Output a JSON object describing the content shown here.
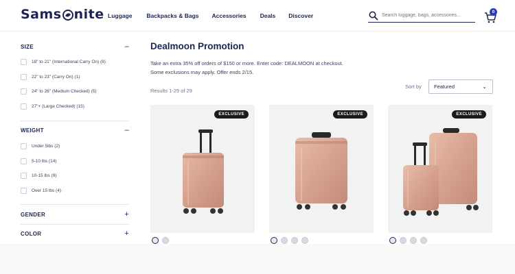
{
  "header": {
    "brand": "Samsonite",
    "nav": [
      "Luggage",
      "Backpacks & Bags",
      "Accessories",
      "Deals",
      "Discover"
    ],
    "search_placeholder": "Search luggage, bags, accessories...",
    "cart_count": "0"
  },
  "sidebar": {
    "size": {
      "label": "SIZE",
      "toggle": "–",
      "options": [
        "18\" to 21\" (International Carry On) (8)",
        "22\" to 23\" (Carry On) (1)",
        "24\" to 26\" (Medium Checked) (5)",
        "27\"+ (Large Checked) (15)"
      ]
    },
    "weight": {
      "label": "WEIGHT",
      "toggle": "–",
      "options": [
        "Under 5lbs (2)",
        "5-10 lbs (14)",
        "10-15 lbs (9)",
        "Over 15 lbs (4)"
      ]
    },
    "gender": {
      "label": "GENDER",
      "toggle": "+"
    },
    "color": {
      "label": "COLOR",
      "toggle": "+"
    }
  },
  "main": {
    "title": "Dealmoon Promotion",
    "promo_line1": "Take an extra 35% off orders of $150 or more. Enter code: DEALMOON at checkout.",
    "promo_line2": "Some exclusions may apply. Offer ends 2/15.",
    "results": "Results 1-29 of 29",
    "sort_label": "Sort by",
    "sort_value": "Featured"
  },
  "products": [
    {
      "badge": "EXCLUSIVE"
    },
    {
      "badge": "EXCLUSIVE"
    },
    {
      "badge": "EXCLUSIVE"
    }
  ],
  "colors": {
    "navy": "#1c2454",
    "accent": "#2b3bb8",
    "rose_gold": "#d9a894"
  }
}
